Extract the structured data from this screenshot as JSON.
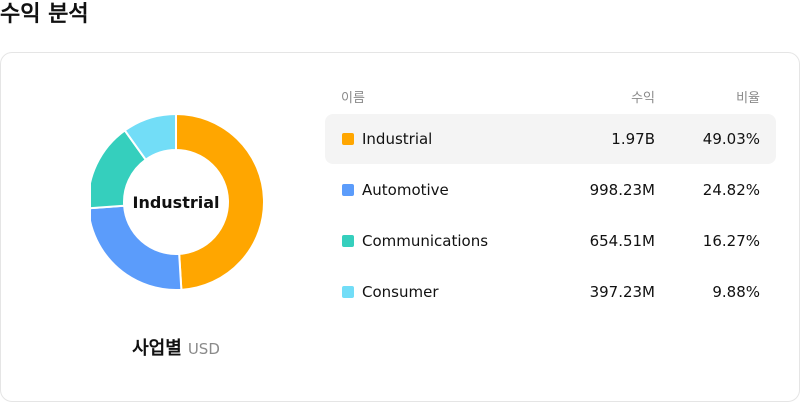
{
  "title": "수익 분석",
  "chart": {
    "center_label": "Industrial",
    "caption_title": "사업별",
    "caption_unit": "USD"
  },
  "table": {
    "headers": {
      "name": "이름",
      "revenue": "수익",
      "ratio": "비율"
    },
    "rows": [
      {
        "name": "Industrial",
        "revenue": "1.97B",
        "ratio": "49.03%",
        "color": "#ffa600",
        "active": true
      },
      {
        "name": "Automotive",
        "revenue": "998.23M",
        "ratio": "24.82%",
        "color": "#5b9cfb",
        "active": false
      },
      {
        "name": "Communications",
        "revenue": "654.51M",
        "ratio": "16.27%",
        "color": "#35cfbd",
        "active": false
      },
      {
        "name": "Consumer",
        "revenue": "397.23M",
        "ratio": "9.88%",
        "color": "#72ddf7",
        "active": false
      }
    ]
  },
  "chart_data": {
    "type": "pie",
    "categories": [
      "Industrial",
      "Automotive",
      "Communications",
      "Consumer"
    ],
    "values": [
      49.03,
      24.82,
      16.27,
      9.88
    ],
    "colors": [
      "#ffa600",
      "#5b9cfb",
      "#35cfbd",
      "#72ddf7"
    ],
    "highlighted": "Industrial"
  }
}
